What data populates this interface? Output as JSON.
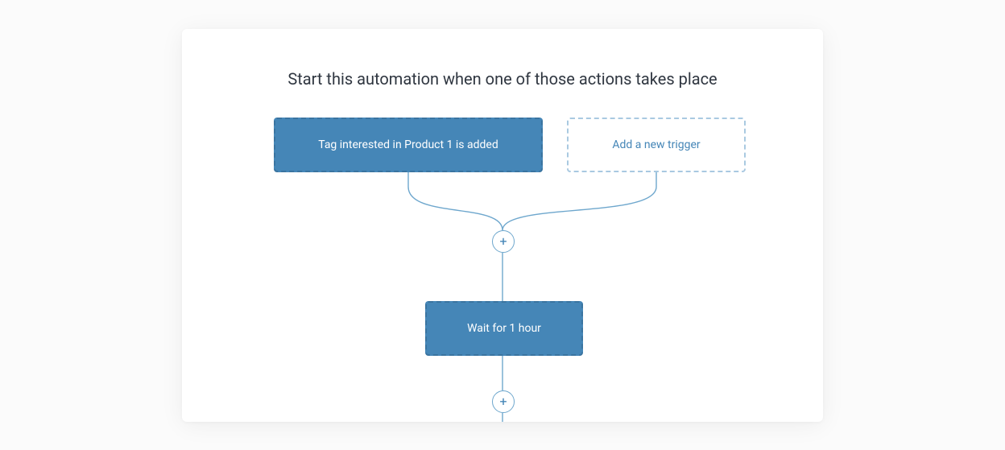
{
  "heading": "Start this automation when one of those actions takes place",
  "triggers": {
    "existing": "Tag interested in Product 1 is added",
    "add_new": "Add a new trigger"
  },
  "steps": {
    "wait": "Wait for 1 hour"
  },
  "buttons": {
    "plus": "+"
  },
  "colors": {
    "accent": "#4586b7",
    "dashed_border": "#a9c9e1",
    "text_dark": "#2f3640"
  }
}
